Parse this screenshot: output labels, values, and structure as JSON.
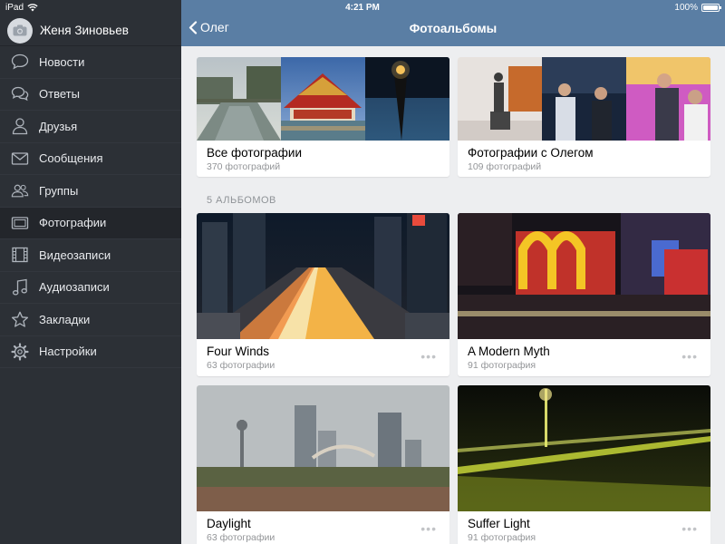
{
  "status_bar": {
    "device": "iPad",
    "time": "4:21 PM",
    "battery": "100%"
  },
  "sidebar": {
    "profile_name": "Женя Зиновьев",
    "items": [
      {
        "label": "Новости",
        "icon": "news-icon"
      },
      {
        "label": "Ответы",
        "icon": "replies-icon"
      },
      {
        "label": "Друзья",
        "icon": "friends-icon"
      },
      {
        "label": "Сообщения",
        "icon": "messages-icon"
      },
      {
        "label": "Группы",
        "icon": "groups-icon"
      },
      {
        "label": "Фотографии",
        "icon": "photos-icon",
        "active": true
      },
      {
        "label": "Видеозаписи",
        "icon": "video-icon"
      },
      {
        "label": "Аудиозаписи",
        "icon": "audio-icon"
      },
      {
        "label": "Закладки",
        "icon": "bookmarks-icon"
      },
      {
        "label": "Настройки",
        "icon": "settings-icon"
      }
    ]
  },
  "header": {
    "back_label": "Олег",
    "title": "Фотоальбомы"
  },
  "top_albums": [
    {
      "title": "Все фотографии",
      "count": "370 фотографий"
    },
    {
      "title": "Фотографии с Олегом",
      "count": "109 фотографий"
    }
  ],
  "section_header": "5 АЛЬБОМОВ",
  "albums": [
    {
      "title": "Four Winds",
      "count": "63 фотографии"
    },
    {
      "title": "A Modern Myth",
      "count": "91 фотография"
    },
    {
      "title": "Daylight",
      "count": "63 фотографии"
    },
    {
      "title": "Suffer Light",
      "count": "91 фотография"
    }
  ],
  "more_label": "•••",
  "colors": {
    "sidebar_bg": "#2c3036",
    "header_bg": "#5a7ea4",
    "content_bg": "#edeef0"
  }
}
